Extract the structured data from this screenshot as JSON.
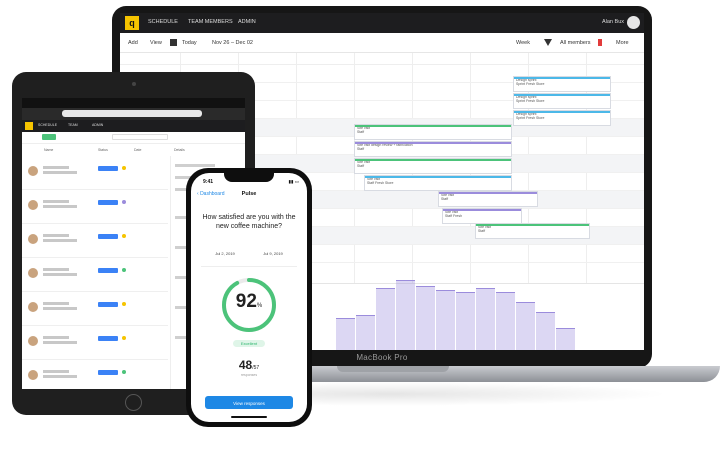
{
  "laptop": {
    "brand_label": "MacBook Pro",
    "nav": [
      "SCHEDULE",
      "TEAM MEMBERS",
      "ADMIN"
    ],
    "user": "Alan Bux",
    "toolbar": {
      "add": "Add",
      "view": "View",
      "today": "Today",
      "range": "Nov 26 – Dec 02",
      "mode": "Week",
      "members": "All members",
      "more": "More"
    },
    "tasks": [
      {
        "title": "Design sprint",
        "sub": "Sprint Fresh Store",
        "color": "#4cb8e8"
      },
      {
        "title": "Design sprint",
        "sub": "Sprint Fresh Store",
        "color": "#4cb8e8"
      },
      {
        "title": "Design sprint",
        "sub": "Sprint Fresh Store",
        "color": "#4cb8e8"
      },
      {
        "title": "Site visit",
        "sub": "Staff",
        "color": "#4cc37a"
      },
      {
        "title": "Site visit design review + fabrication",
        "sub": "Staff",
        "color": "#9b8cdc"
      },
      {
        "title": "Site visit",
        "sub": "Staff",
        "color": "#4cc37a"
      },
      {
        "title": "Site visit",
        "sub": "Staff Fresh Store",
        "color": "#4cb8e8"
      },
      {
        "title": "Site visit",
        "sub": "Staff",
        "color": "#9b8cdc"
      },
      {
        "title": "Site visit",
        "sub": "Staff Fresh",
        "color": "#9b8cdc"
      },
      {
        "title": "Site visit",
        "sub": "Staff",
        "color": "#4cc37a"
      }
    ],
    "histogram": [
      32,
      35,
      62,
      70,
      64,
      60,
      58,
      62,
      58,
      48,
      38,
      22
    ]
  },
  "tablet": {
    "nav": [
      "SCHEDULE",
      "TEAM",
      "ADMIN"
    ],
    "columns": [
      "Name",
      "Status",
      "Date",
      "Details"
    ]
  },
  "phone": {
    "time": "9:41",
    "back": "Dashboard",
    "title": "Pulse",
    "question": "How satisfied are you with the new coffee machine?",
    "date_from": "Jul 2, 2019",
    "date_to": "Jul 9, 2019",
    "score": "92",
    "score_unit": "%",
    "score_level": 0.92,
    "tag": "Excellent",
    "count": "48",
    "count_unit": "/57",
    "count_sub": "responses",
    "cta": "View responses"
  }
}
